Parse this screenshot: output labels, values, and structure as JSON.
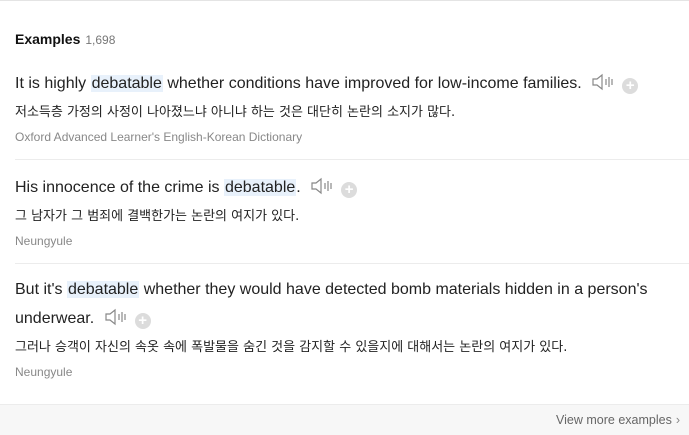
{
  "header": {
    "title": "Examples",
    "count": "1,698"
  },
  "examples": [
    {
      "before": "It is highly ",
      "keyword": "debatable",
      "after": " whether conditions have improved for low-income families.",
      "translation": "저소득층 가정의 사정이 나아졌느냐 아니냐 하는 것은 대단히 논란의 소지가 많다.",
      "source": "Oxford Advanced Learner's English-Korean Dictionary"
    },
    {
      "before": "His innocence of the crime is ",
      "keyword": "debatable",
      "after": ".",
      "translation": "그 남자가 그 범죄에 결백한가는 논란의 여지가 있다.",
      "source": "Neungyule"
    },
    {
      "before": "But it's ",
      "keyword": "debatable",
      "after": " whether they would have detected bomb materials hidden in a person's underwear.",
      "translation": "그러나 승객이 자신의 속옷 속에 폭발물을 숨긴 것을 감지할 수 있을지에 대해서는 논란의 여지가 있다.",
      "source": "Neungyule"
    }
  ],
  "icons": {
    "audio": "speaker-icon",
    "add": "plus-icon",
    "more": "chevron-right-icon"
  },
  "footer": {
    "more_label": "View more examples"
  }
}
